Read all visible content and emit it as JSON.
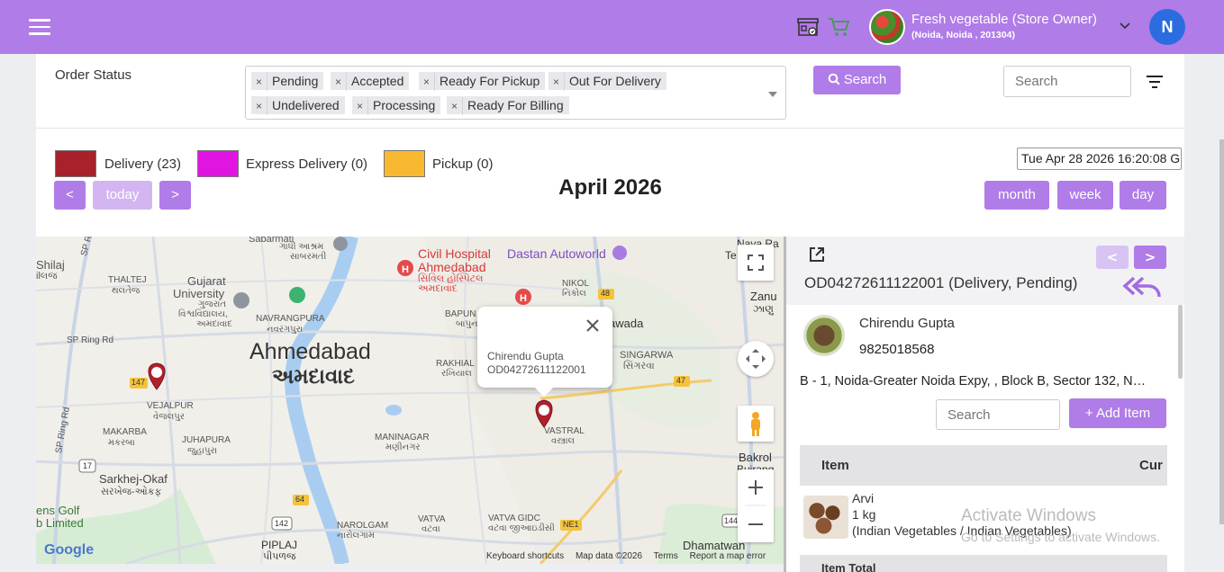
{
  "header": {
    "store_name": "Fresh vegetable (Store Owner)",
    "store_location": "(Noida, Noida , 201304)",
    "user_initial": "N"
  },
  "filters": {
    "order_status_label": "Order Status",
    "tags": [
      "Pending",
      "Accepted",
      "Ready For Pickup",
      "Out For Delivery",
      "Undelivered",
      "Processing",
      "Ready For Billing"
    ],
    "search_button": "Search",
    "search_placeholder": "Search"
  },
  "calendar": {
    "legend": [
      {
        "label": "Delivery (23)",
        "color": "#a8212b"
      },
      {
        "label": "Express Delivery (0)",
        "color": "#e114e1"
      },
      {
        "label": "Pickup (0)",
        "color": "#f8b930"
      }
    ],
    "datetime": "Tue Apr 28 2026 16:20:08 G",
    "prev": "<",
    "today": "today",
    "next": ">",
    "title": "April 2026",
    "views": [
      "month",
      "week",
      "day"
    ]
  },
  "map": {
    "labels": {
      "city_en": "Ahmedabad",
      "city_gu": "અમદાવાદ",
      "hospital": "Civil Hospital",
      "hospital2": "Ahmedabad",
      "hospital_gu": "સિવિલ હોસ્પિટલ",
      "hospital_gu2": "અમદાવાદ",
      "dastan": "Dastan Autoworld",
      "gujarat_uni": "Gujarat",
      "gujarat_uni2": "University",
      "gujarat_uni_gu": "ગુજરાત",
      "gujarat_uni_gu2": "વિશ્વવિદ્યાલય,",
      "gujarat_uni_gu3": "અમદાવાદ",
      "navrangpura": "NAVRANGPURA",
      "navrangpura_gu": "નવરંગપુરા",
      "thaltej": "THALTEJ",
      "thaltej_gu": "થલતેજ",
      "shilaj": "Shilaj",
      "shilaj_gu": "ilલજ",
      "vejalpur": "VEJALPUR",
      "vejalpur_gu": "વેજલપુર",
      "makarba": "MAKARBA",
      "makarba_gu": "મકરબા",
      "juhapura": "JUHAPURA",
      "juhapura_gu": "જુહાપુરા",
      "sarkhej": "Sarkhej-Okaf",
      "sarkhej_gu": "સરખેજ-ઓકફ",
      "golf": "ens Golf",
      "golf2": "b Limited",
      "maninagar": "MANINAGAR",
      "maninagar_gu": "મણીનગર",
      "rakhial": "RAKHIAL",
      "rakhial_gu": "રખિયાલ",
      "bapunagar": "BAPUN",
      "bapunagar_gu": "બાપુન",
      "vastral": "VASTRAL",
      "vastral_gu": "વસ્ત્રાલ",
      "singarwa": "SINGARWA",
      "singarwa_gu": "સિંગરવા",
      "nikol": "NIKOL",
      "nikol_gu": "નિકોલ",
      "zanu": "Zanu",
      "zanu_gu": "ઝાણુ",
      "naroda": "Nava Ra",
      "tenu": "Te",
      "wada": "awada",
      "bakrol": "Bakrol",
      "bakrol2": "Bujrang",
      "narol": "NAROLGAM",
      "narol_gu": "નારોલગામ",
      "vatva": "VATVA",
      "vatva_gu": "વટવા",
      "vatva_gidc": "VATVA GIDC",
      "vatva_gidc_gu": "વટવા જીઆઇડીસી",
      "piplaj": "PIPLAJ",
      "piplaj_gu": "પીપળજ",
      "dhamatwan": "Dhamatwan",
      "sp_ring": "SP Ring",
      "sp_ring2": "SP Ring Rd",
      "sp_ring3": "SP Ring Rd",
      "sabarmati": "Sabarmati",
      "gandhi": "ગાંધી આશ્રમ",
      "sabarmati_gu": "સાબરમતી",
      "road_147": "147",
      "road_17": "17",
      "road_64": "64",
      "road_142": "142",
      "road_48": "48",
      "road_47": "47",
      "road_ne1": "NE1",
      "road_144": "144",
      "google": "Google"
    },
    "info_window": {
      "name": "Chirendu Gupta",
      "order": "OD04272611122001"
    },
    "footer": [
      "Keyboard shortcuts",
      "Map data ©2026",
      "Terms",
      "Report a map error"
    ]
  },
  "order_panel": {
    "order_title": "OD04272611122001 (Delivery, Pending)",
    "prev": "<",
    "next": ">",
    "customer_name": "Chirendu Gupta",
    "customer_phone": "9825018568",
    "address": "B - 1, Noida-Greater Noida Expy, , Block B, Sector 132, Noida",
    "search_placeholder": "Search",
    "add_item": "Add Item",
    "columns": [
      "Item",
      "Cur"
    ],
    "item": {
      "name": "Arvi",
      "qty": "1 kg",
      "category": "(Indian Vegetables / Indian Vegetables)"
    },
    "item_total": "Item Total"
  },
  "watermark": {
    "line1": "Activate Windows",
    "line2": "Go to Settings to activate Windows."
  }
}
